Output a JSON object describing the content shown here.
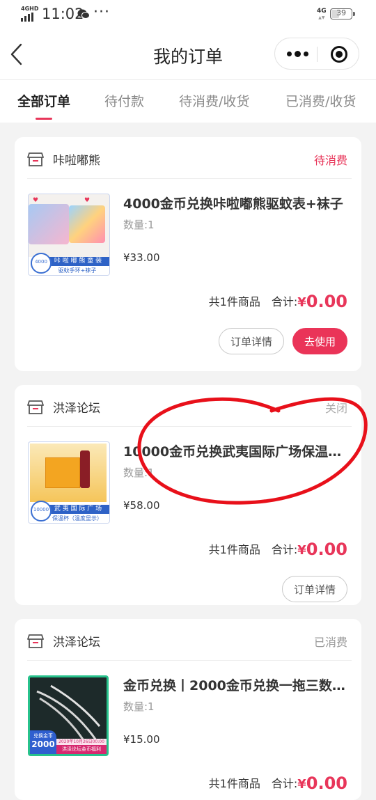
{
  "status_bar": {
    "network": "4GHD",
    "time": "11:02",
    "more_dots": "···",
    "network_right": "4G",
    "battery": "39"
  },
  "nav": {
    "title": "我的订单"
  },
  "tabs": [
    {
      "label": "全部订单",
      "active": true
    },
    {
      "label": "待付款",
      "active": false
    },
    {
      "label": "待消费/收货",
      "active": false
    },
    {
      "label": "已消费/收货",
      "active": false
    }
  ],
  "orders": [
    {
      "shop": "咔啦嘟熊",
      "status": "待消费",
      "status_color": "#e8365a",
      "title": "4000金币兑换咔啦嘟熊驱蚊表+袜子",
      "qty": "数量:1",
      "price": "¥33.00",
      "count_text": "共1件商品",
      "total_label": "合计:",
      "total_currency": "¥",
      "total_amount": "0.00",
      "thumb": {
        "band": "咔 啦 嘟 熊 童 装",
        "sub": "驱蚊手环+袜子",
        "coin": "4000"
      },
      "buttons": [
        "订单详情",
        "去使用"
      ]
    },
    {
      "shop": "洪泽论坛",
      "status": "关闭",
      "status_color": "#aaaaaa",
      "title": "10000金币兑换武夷国际广场保温…",
      "qty": "数量:1",
      "price": "¥58.00",
      "count_text": "共1件商品",
      "total_label": "合计:",
      "total_currency": "¥",
      "total_amount": "0.00",
      "thumb": {
        "band": "武 夷 国 际 广 场",
        "sub": "保温杯（温度显示）",
        "coin": "10000"
      },
      "buttons": [
        "订单详情"
      ]
    },
    {
      "shop": "洪泽论坛",
      "status": "已消费",
      "status_color": "#999999",
      "title": "金币兑换丨2000金币兑换一拖三数…",
      "qty": "数量:1",
      "price": "¥15.00",
      "count_text": "共1件商品",
      "total_label": "合计:",
      "total_currency": "¥",
      "total_amount": "0.00",
      "thumb": {
        "badge_top": "兑换金币",
        "coin": "2000",
        "band": "洪泽论坛金币福利",
        "date": "2020年10月26日00:00"
      },
      "buttons": []
    }
  ]
}
